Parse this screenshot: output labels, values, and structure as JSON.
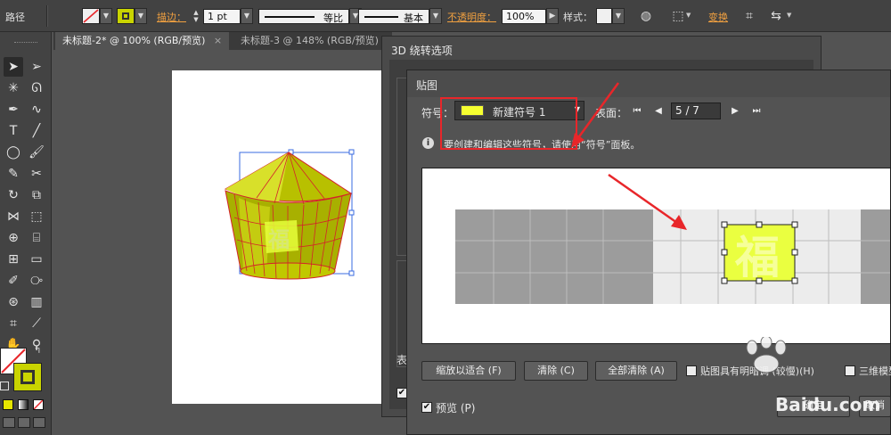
{
  "control_bar": {
    "object_type": "路径",
    "stroke_label": "描边：",
    "stroke_weight": "1 pt",
    "profile_label": "等比",
    "brush_label": "基本",
    "opacity_label": "不透明度：",
    "opacity_value": "100%",
    "style_label": "样式：",
    "transform_label": "变换"
  },
  "doc_tabs": [
    {
      "label": "未标题-2* @ 100% (RGB/预览)",
      "close": "×"
    },
    {
      "label": "未标题-3 @ 148% (RGB/预览)",
      "close": "×"
    }
  ],
  "dialog_3d": {
    "title": "3D 绕转选项",
    "side_label": "表"
  },
  "dialog_map": {
    "title": "贴图",
    "symbol_label": "符号：",
    "symbol_value": "新建符号 1",
    "surface_label": "表面：",
    "page_value": "5 / 7",
    "info_text": "要创建和编辑这些符号，请使用“符号”面板。",
    "buttons": {
      "scale_to_fit": "缩放以适合 (F)",
      "clear": "清除 (C)",
      "clear_all": "全部清除 (A)",
      "ok": "确定",
      "cancel": "取消"
    },
    "shade_label": "贴图具有明暗调 (较慢)(H)",
    "invisible_geometry_label": "三维模型不可见",
    "preview_label": "预览 (P)",
    "preview_checked": true
  },
  "watermark": {
    "text": "Baidu.com"
  },
  "colors": {
    "accent_orange": "#f0a040",
    "fill_yellow": "#e6ff3a",
    "annotation_red": "#e8262a"
  }
}
